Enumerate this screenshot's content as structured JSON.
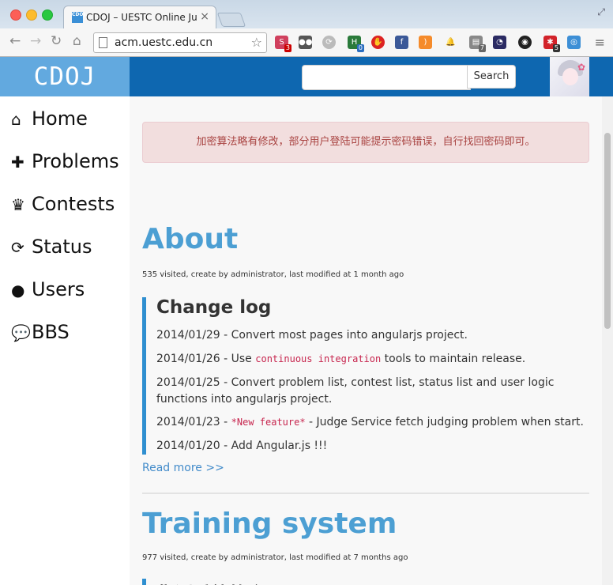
{
  "browser": {
    "tab_title": "CDOJ – UESTC Online Judge",
    "tab_favicon": "CDOJ",
    "url": "acm.uestc.edu.cn",
    "extension_badges": [
      "3",
      "0",
      "7",
      "5"
    ]
  },
  "header": {
    "brand": "CDOJ",
    "search_placeholder": "",
    "search_button": "Search"
  },
  "sidebar": {
    "items": [
      {
        "label": "Home",
        "icon": "home-icon"
      },
      {
        "label": "Problems",
        "icon": "puzzle-icon"
      },
      {
        "label": "Contests",
        "icon": "trophy-icon"
      },
      {
        "label": "Status",
        "icon": "refresh-icon"
      },
      {
        "label": "Users",
        "icon": "user-icon"
      },
      {
        "label": "BBS",
        "icon": "comments-icon"
      }
    ]
  },
  "alert": "加密算法略有修改，部分用户登陆可能提示密码错误，自行找回密码即可。",
  "articles": [
    {
      "title": "About",
      "meta": "535 visited, create by administrator, last modified at 1 month ago",
      "section_title": "Change log",
      "entries": [
        {
          "text": "2014/01/29 - Convert most pages into angularjs project."
        },
        {
          "pre": "2014/01/26 - Use ",
          "code": "continuous integration",
          "post": " tools to maintain release."
        },
        {
          "text": "2014/01/25 - Convert problem list, contest list, status list and user logic functions into angularjs project."
        },
        {
          "pre": "2014/01/23 - ",
          "code": "*New feature*",
          "post": " - Judge Service fetch judging problem when start."
        },
        {
          "text": "2014/01/20 - Add Angular.js !!!"
        }
      ],
      "read_more": "Read more >>"
    },
    {
      "title": "Training system",
      "meta": "977 visited, create by administrator, last modified at 7 months ago",
      "section_title": "集训系统简介"
    }
  ],
  "colors": {
    "header_bg": "#0e67b0",
    "brand_bg": "#62a9df",
    "title_color": "#4c9fd3",
    "alert_bg": "#f2dede",
    "alert_text": "#a94442",
    "code_text": "#c7254e"
  }
}
